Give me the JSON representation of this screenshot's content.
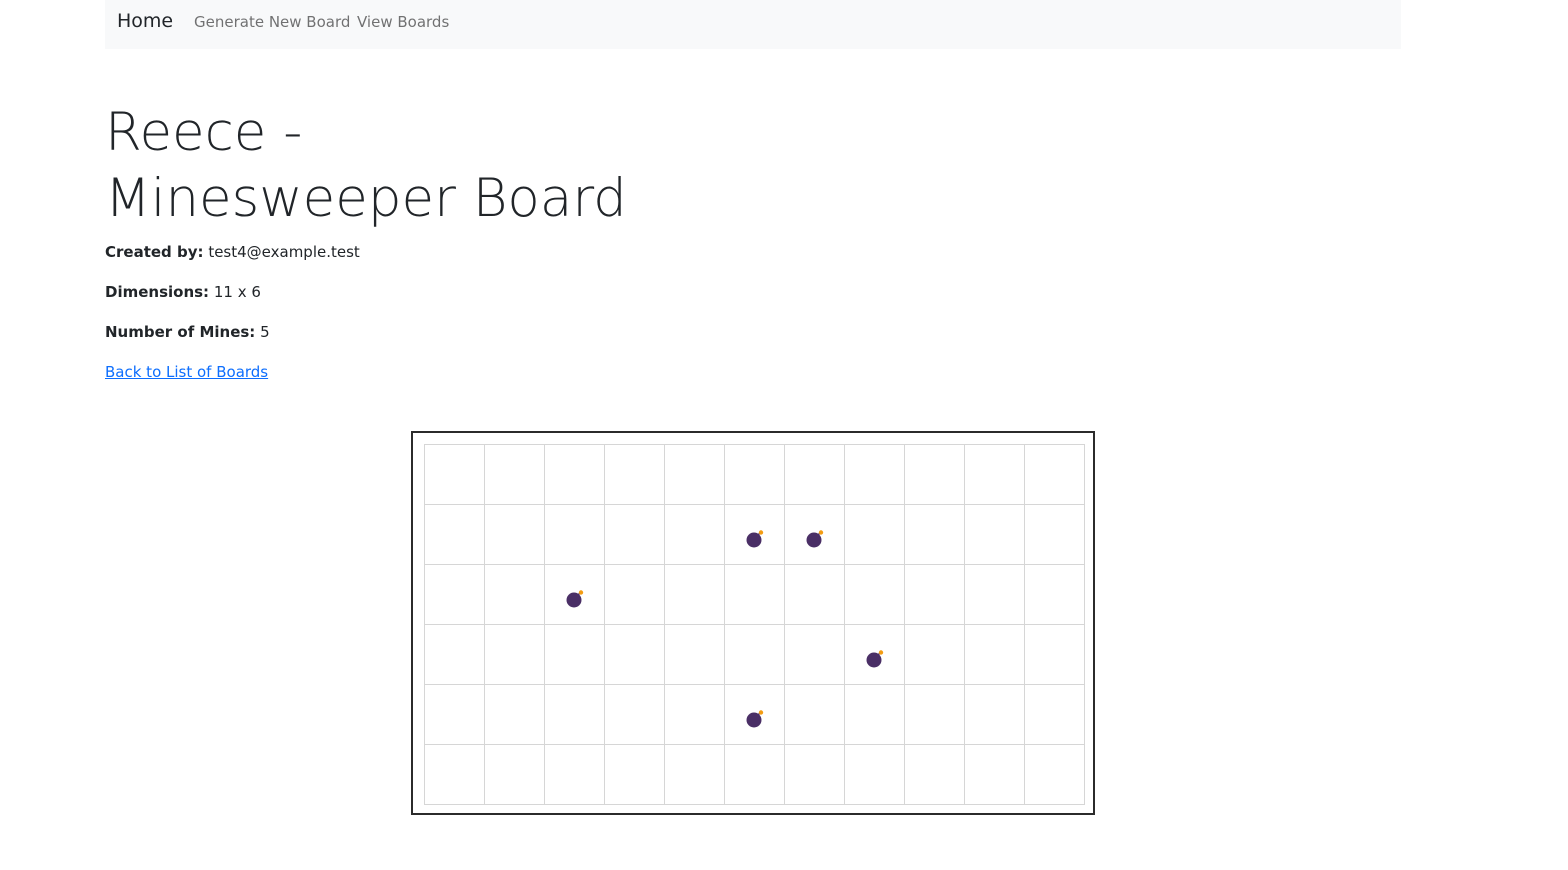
{
  "nav": {
    "brand": "Home",
    "links": [
      "Generate New Board",
      "View Boards"
    ]
  },
  "page": {
    "title": "Reece - Minesweeper Board",
    "created_by_label": "Created by:",
    "created_by_value": "test4@example.test",
    "dimensions_label": "Dimensions:",
    "dimensions_value": "11 x 6",
    "mines_label": "Number of Mines:",
    "mines_value": "5",
    "back_link": "Back to List of Boards"
  },
  "board": {
    "columns": 11,
    "rows": 6,
    "mines": [
      {
        "row": 1,
        "col": 5
      },
      {
        "row": 1,
        "col": 6
      },
      {
        "row": 2,
        "col": 2
      },
      {
        "row": 3,
        "col": 7
      },
      {
        "row": 4,
        "col": 5
      }
    ],
    "mine_icon": "bomb-icon",
    "colors": {
      "mine_body": "#4a2f66",
      "fuse_spark": "#f39c12",
      "grid_line": "#d6d6d6",
      "board_border": "#2b2b2b"
    }
  }
}
